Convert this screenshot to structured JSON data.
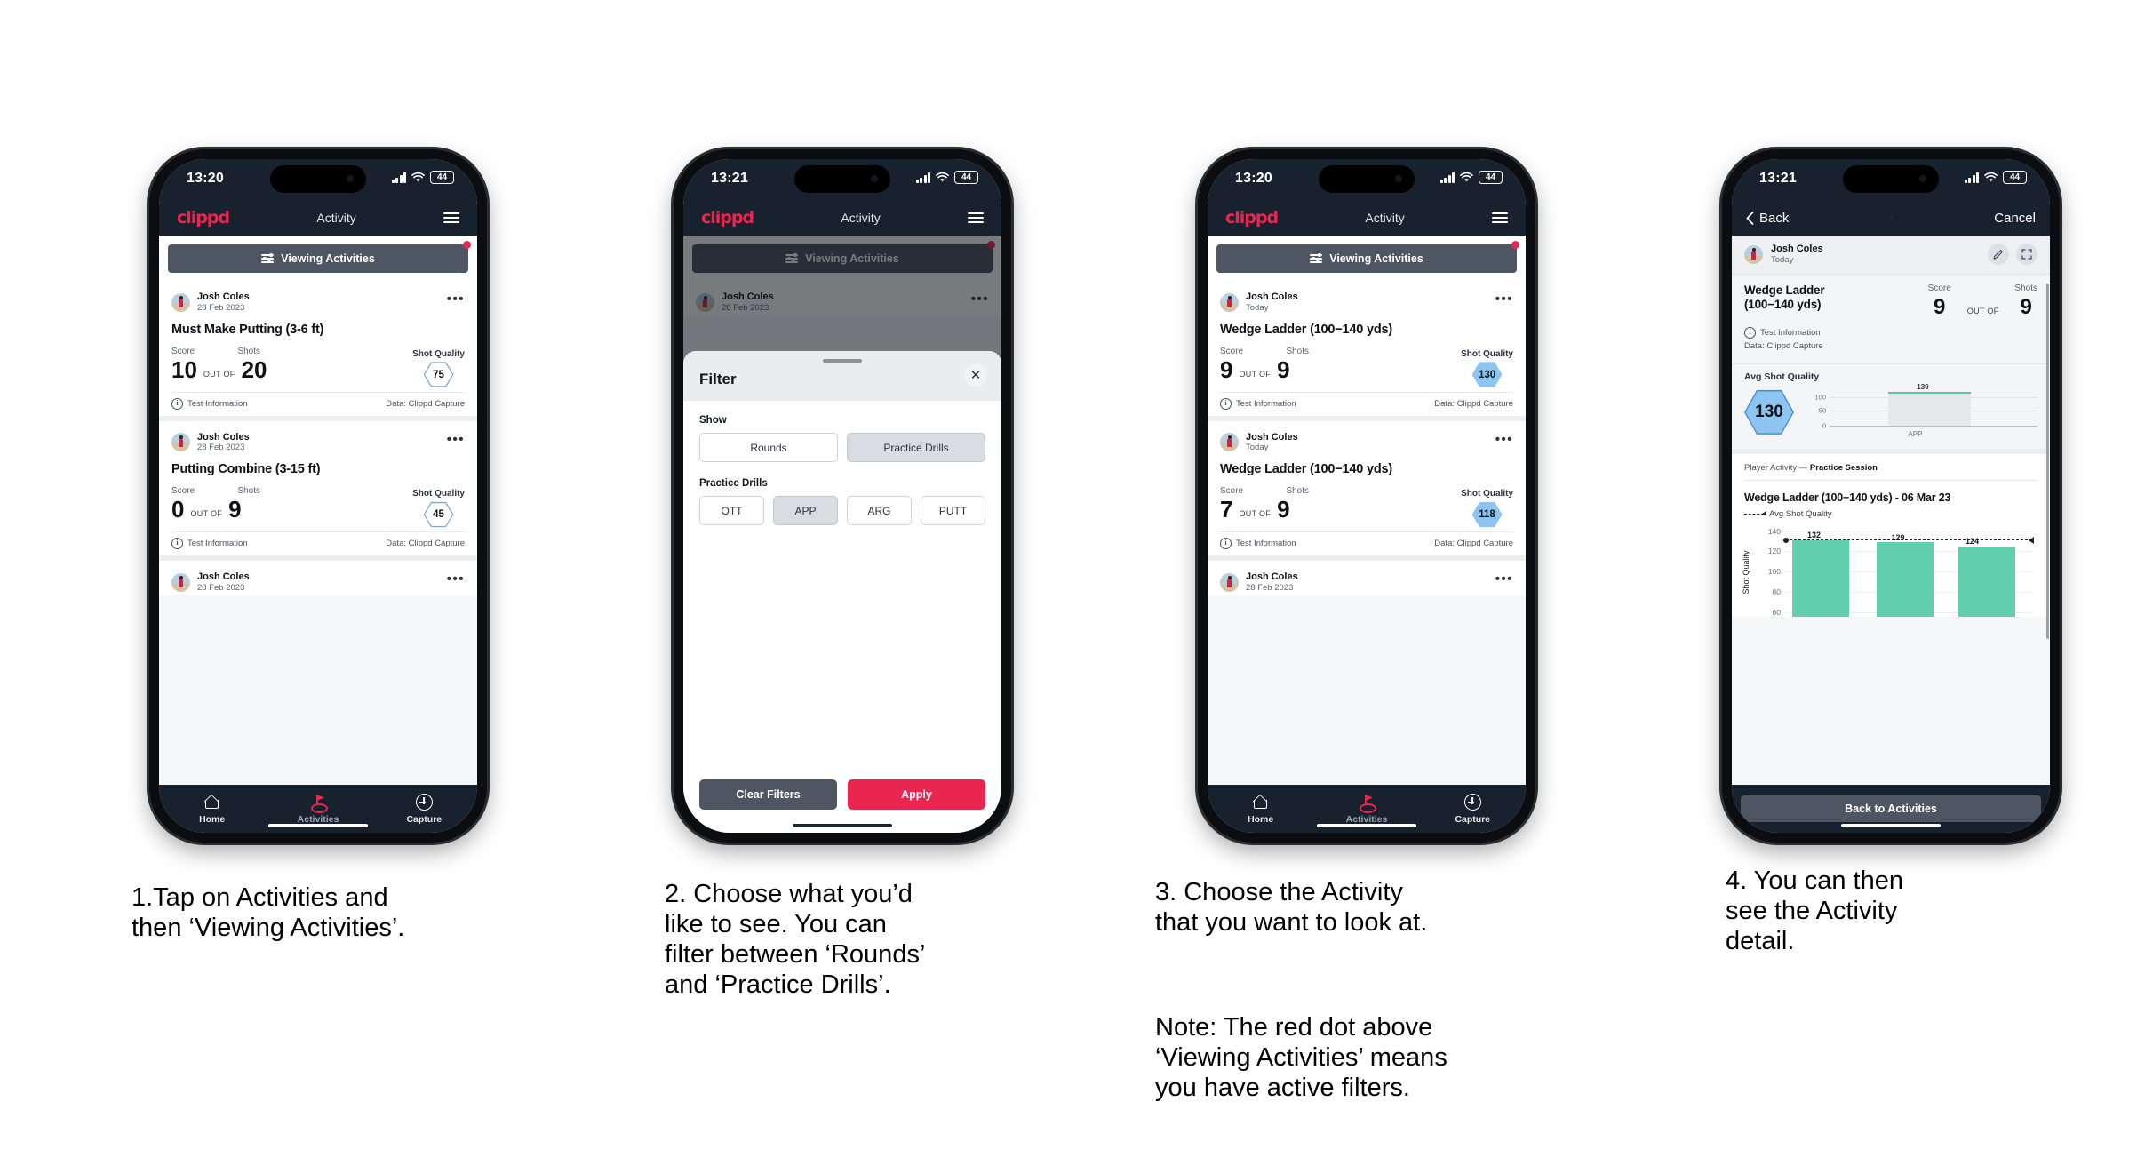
{
  "status": {
    "time1": "13:20",
    "time2": "13:21",
    "battery": "44"
  },
  "app": {
    "logo": "clippd",
    "title": "Activity"
  },
  "filter_bar": {
    "label": "Viewing Activities"
  },
  "tabs": [
    {
      "label": "Home",
      "icon": "home-icon"
    },
    {
      "label": "Activities",
      "icon": "golf-flag-icon"
    },
    {
      "label": "Capture",
      "icon": "plus-circle-icon"
    }
  ],
  "labels": {
    "score": "Score",
    "shots": "Shots",
    "shot_quality": "Shot Quality",
    "out_of": "OUT OF",
    "test_information": "Test Information",
    "data_source": "Data: Clippd Capture"
  },
  "phone1": {
    "cards": [
      {
        "user": "Josh Coles",
        "date": "28 Feb 2023",
        "title": "Must Make Putting (3-6 ft)",
        "score": "10",
        "shots": "20",
        "quality": "75",
        "quality_style": "outline"
      },
      {
        "user": "Josh Coles",
        "date": "28 Feb 2023",
        "title": "Putting Combine (3-15 ft)",
        "score": "0",
        "shots": "9",
        "quality": "45",
        "quality_style": "outline"
      },
      {
        "user": "Josh Coles",
        "date": "28 Feb 2023"
      }
    ]
  },
  "phone2": {
    "sheet_title": "Filter",
    "show_label": "Show",
    "show_options": [
      {
        "label": "Rounds",
        "selected": false
      },
      {
        "label": "Practice Drills",
        "selected": true
      }
    ],
    "drills_label": "Practice Drills",
    "drill_options": [
      {
        "label": "OTT",
        "selected": false
      },
      {
        "label": "APP",
        "selected": true
      },
      {
        "label": "ARG",
        "selected": false
      },
      {
        "label": "PUTT",
        "selected": false
      }
    ],
    "clear_label": "Clear Filters",
    "apply_label": "Apply",
    "close_icon": "close-icon"
  },
  "phone3": {
    "cards": [
      {
        "user": "Josh Coles",
        "date": "Today",
        "title": "Wedge Ladder (100−140 yds)",
        "score": "9",
        "shots": "9",
        "quality": "130",
        "quality_style": "blue"
      },
      {
        "user": "Josh Coles",
        "date": "Today",
        "title": "Wedge Ladder (100−140 yds)",
        "score": "7",
        "shots": "9",
        "quality": "118",
        "quality_style": "blue"
      },
      {
        "user": "Josh Coles",
        "date": "28 Feb 2023"
      }
    ]
  },
  "phone4": {
    "back_label": "Back",
    "cancel_label": "Cancel",
    "user": "Josh Coles",
    "date": "Today",
    "edit_icon": "pencil-icon",
    "expand_icon": "expand-icon",
    "title": "Wedge Ladder\n(100−140 yds)",
    "score": "9",
    "shots": "9",
    "test_information": "Test Information",
    "data_source": "Data: Clippd Capture",
    "avg_label": "Avg Shot Quality",
    "avg_value": "130",
    "player_activity_prefix": "Player Activity — ",
    "player_activity_value": "Practice Session",
    "chart_title": "Wedge Ladder (100−140 yds) - 06 Mar 23",
    "legend_label": "Avg Shot Quality",
    "y_axis_label": "Shot Quality",
    "back_to_activities": "Back to Activities"
  },
  "chart_data": [
    {
      "type": "bar",
      "name": "avg-shot-quality-mini",
      "categories": [
        "APP"
      ],
      "values": [
        130
      ],
      "data_labels": [
        "130"
      ],
      "ytick_labels": [
        "100",
        "50",
        "0"
      ],
      "ylim": [
        0,
        150
      ],
      "title": "Avg Shot Quality",
      "xlabel": "",
      "ylabel": "",
      "grid": true,
      "legend": "none"
    },
    {
      "type": "bar",
      "name": "session-shot-quality",
      "categories": [
        "1",
        "2",
        "3"
      ],
      "values": [
        132,
        129,
        124
      ],
      "data_labels": [
        "132",
        "129",
        "124"
      ],
      "ytick_labels": [
        "140",
        "120",
        "100",
        "80",
        "60"
      ],
      "ylim": [
        50,
        145
      ],
      "title": "Wedge Ladder (100−140 yds) - 06 Mar 23",
      "xlabel": "",
      "ylabel": "Shot Quality",
      "grid": true,
      "legend": "Avg Shot Quality",
      "avg_line": 130,
      "bar_color": "#62d0ae"
    }
  ],
  "captions": {
    "c1": "1.Tap on Activities and\nthen ‘Viewing Activities’.",
    "c2": "2. Choose what you’d\nlike to see. You can\nfilter between ‘Rounds’\nand ‘Practice Drills’.",
    "c3": "3. Choose the Activity\nthat you want to look at.",
    "c3b": "Note: The red dot above\n‘Viewing Activities’ means\nyou have active filters.",
    "c4": "4. You can then\nsee the Activity\ndetail."
  },
  "colors": {
    "accent": "#e8264f",
    "dark": "#18212e",
    "slate": "#4d5662",
    "hex_blue": "#8ec5f0",
    "bar_green": "#62d0ae"
  }
}
